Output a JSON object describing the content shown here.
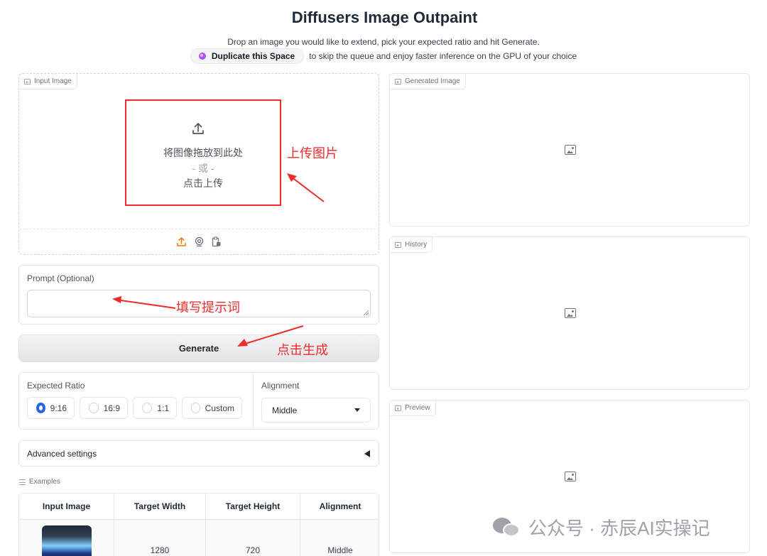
{
  "header": {
    "title": "Diffusers Image Outpaint",
    "subtitle": "Drop an image you would like to extend, pick your expected ratio and hit Generate.",
    "duplicate_button": "Duplicate this Space",
    "duplicate_suffix": "to skip the queue and enjoy faster inference on the GPU of your choice"
  },
  "input_image": {
    "tag": "Input Image",
    "drop_text": "将图像拖放到此处",
    "or_text": "- 或 -",
    "click_text": "点击上传",
    "sources": [
      "upload-icon",
      "webcam-icon",
      "clipboard-icon"
    ]
  },
  "prompt": {
    "label": "Prompt (Optional)",
    "value": ""
  },
  "generate": {
    "label": "Generate"
  },
  "ratio": {
    "label": "Expected Ratio",
    "options": [
      "9:16",
      "16:9",
      "1:1",
      "Custom"
    ],
    "selected": "9:16"
  },
  "alignment": {
    "label": "Alignment",
    "value": "Middle"
  },
  "advanced": {
    "label": "Advanced settings"
  },
  "examples": {
    "label": "Examples",
    "headers": [
      "Input Image",
      "Target Width",
      "Target Height",
      "Alignment"
    ],
    "rows": [
      {
        "width": "1280",
        "height": "720",
        "alignment": "Middle"
      }
    ]
  },
  "outputs": {
    "generated": "Generated Image",
    "history": "History",
    "preview": "Preview"
  },
  "annotations": {
    "upload": "上传图片",
    "prompt": "填写提示词",
    "generate": "点击生成",
    "color": "#ef2b2b"
  },
  "watermark": {
    "text": "公众号 · 赤辰AI实操记"
  },
  "colors": {
    "accent": "#2563eb",
    "upload_icon": "#f97316"
  }
}
